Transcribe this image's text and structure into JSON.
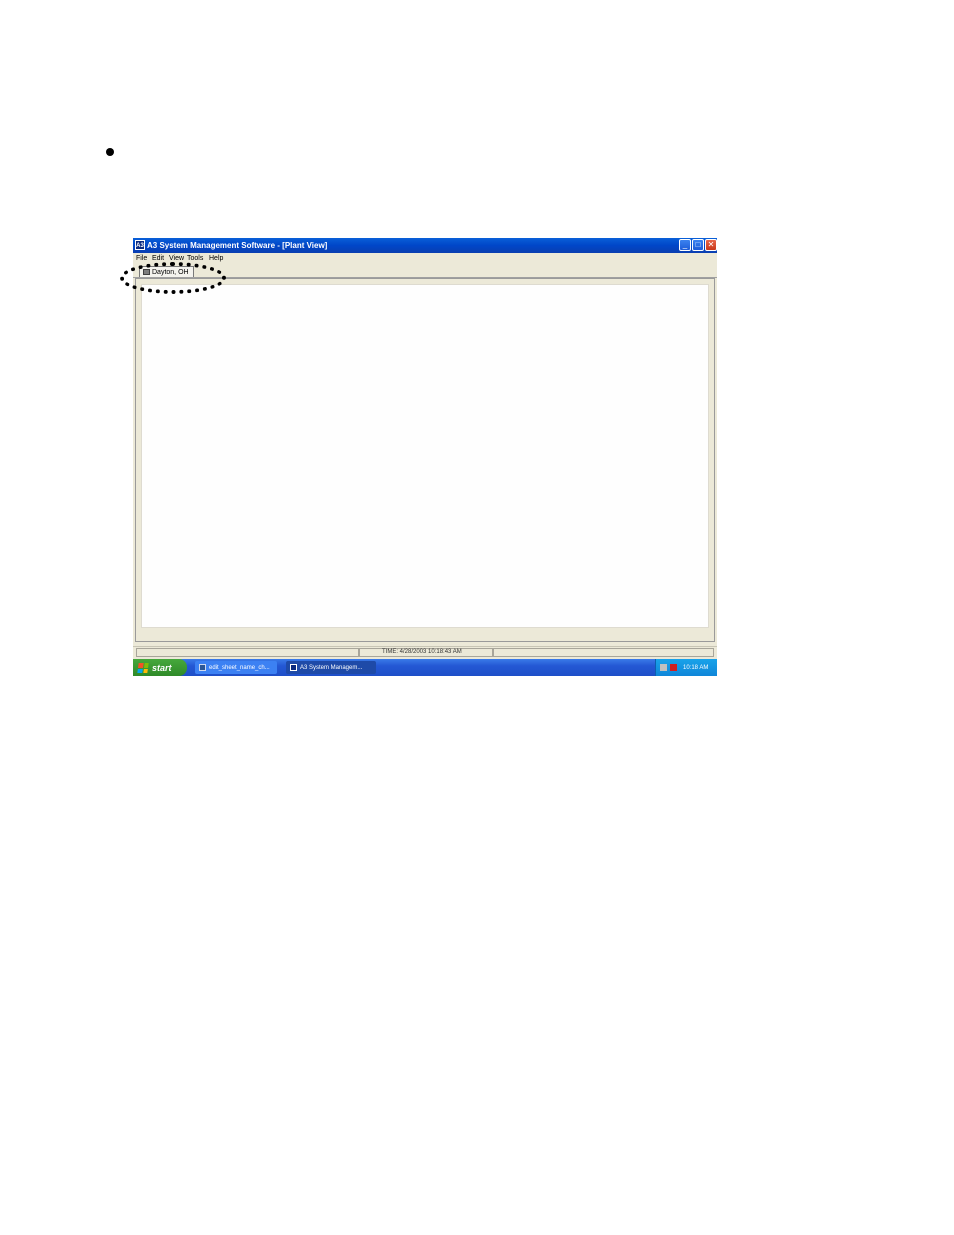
{
  "window": {
    "icon_label": "A3",
    "title": "A3 System Management Software - [Plant View]",
    "minimize_glyph": "_",
    "maximize_glyph": "□",
    "close_glyph": "✕"
  },
  "menubar": {
    "items": [
      {
        "label": "File"
      },
      {
        "label": "Edit"
      },
      {
        "label": "View"
      },
      {
        "label": "Tools"
      },
      {
        "label": "Help"
      }
    ]
  },
  "tabs": [
    {
      "label": "Dayton, OH",
      "icon": "building-icon",
      "selected": true
    }
  ],
  "statusbar": {
    "time": "TIME:  4/28/2003 10:18:43 AM"
  },
  "taskbar": {
    "start_label": "start",
    "tasks": [
      {
        "label": "edit_sheet_name_ch...",
        "icon": "document-icon",
        "active": false
      },
      {
        "label": "A3 System Managem...",
        "icon": "app-icon",
        "active": true
      }
    ],
    "clock": "10:18 AM"
  },
  "colors": {
    "titlebar": "#0046c8",
    "window_face": "#ece9d8",
    "taskbar": "#2458d4",
    "start_button": "#3c9a33",
    "annotation": "#000000"
  }
}
